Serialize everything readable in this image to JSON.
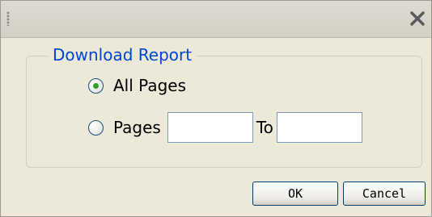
{
  "dialog": {
    "close_glyph": "×",
    "group": {
      "legend": "Download Report",
      "options": [
        {
          "label": "All Pages",
          "checked": true
        },
        {
          "label": "Pages",
          "checked": false
        }
      ],
      "from_value": "",
      "to_label": "To",
      "to_value": ""
    },
    "buttons": {
      "ok_label": "OK",
      "cancel_label": "Cancel"
    }
  },
  "colors": {
    "legend_text": "#0046d5",
    "dialog_background": "#ece9d8",
    "radio_dot": "#2f9e2f",
    "button_border": "#003c74"
  }
}
